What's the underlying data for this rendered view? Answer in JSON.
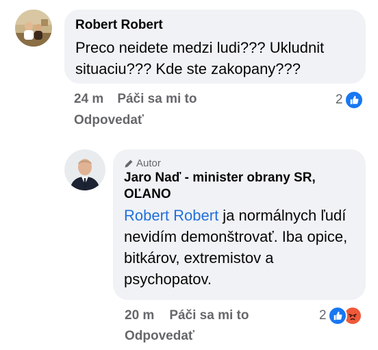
{
  "comment1": {
    "author": "Robert Robert",
    "text": "Preco neidete medzi ludi??? Ukludnit situaciu??? Kde ste zakopany???",
    "time": "24 m",
    "like_label": "Páči sa mi to",
    "reaction_count": "2",
    "reply_label": "Odpovedať",
    "reactions": [
      "like-icon"
    ]
  },
  "comment2": {
    "badge": "Autor",
    "author_line1": "Jaro Naď - minister obrany SR,",
    "author_line2": "OĽANO",
    "mention": "Robert Robert",
    "text_rest": " ja normálnych ľudí nevidím demonštrovať. Iba opice, bitkárov, extremistov a psychopatov.",
    "time": "20 m",
    "like_label": "Páči sa mi to",
    "reaction_count": "2",
    "reply_label": "Odpovedať",
    "reactions": [
      "like-icon",
      "angry-icon"
    ]
  },
  "colors": {
    "bubble": "#f0f2f5",
    "meta": "#65676b",
    "mention": "#216fdb",
    "like": "#1877f2",
    "angry": "#f0593a"
  }
}
